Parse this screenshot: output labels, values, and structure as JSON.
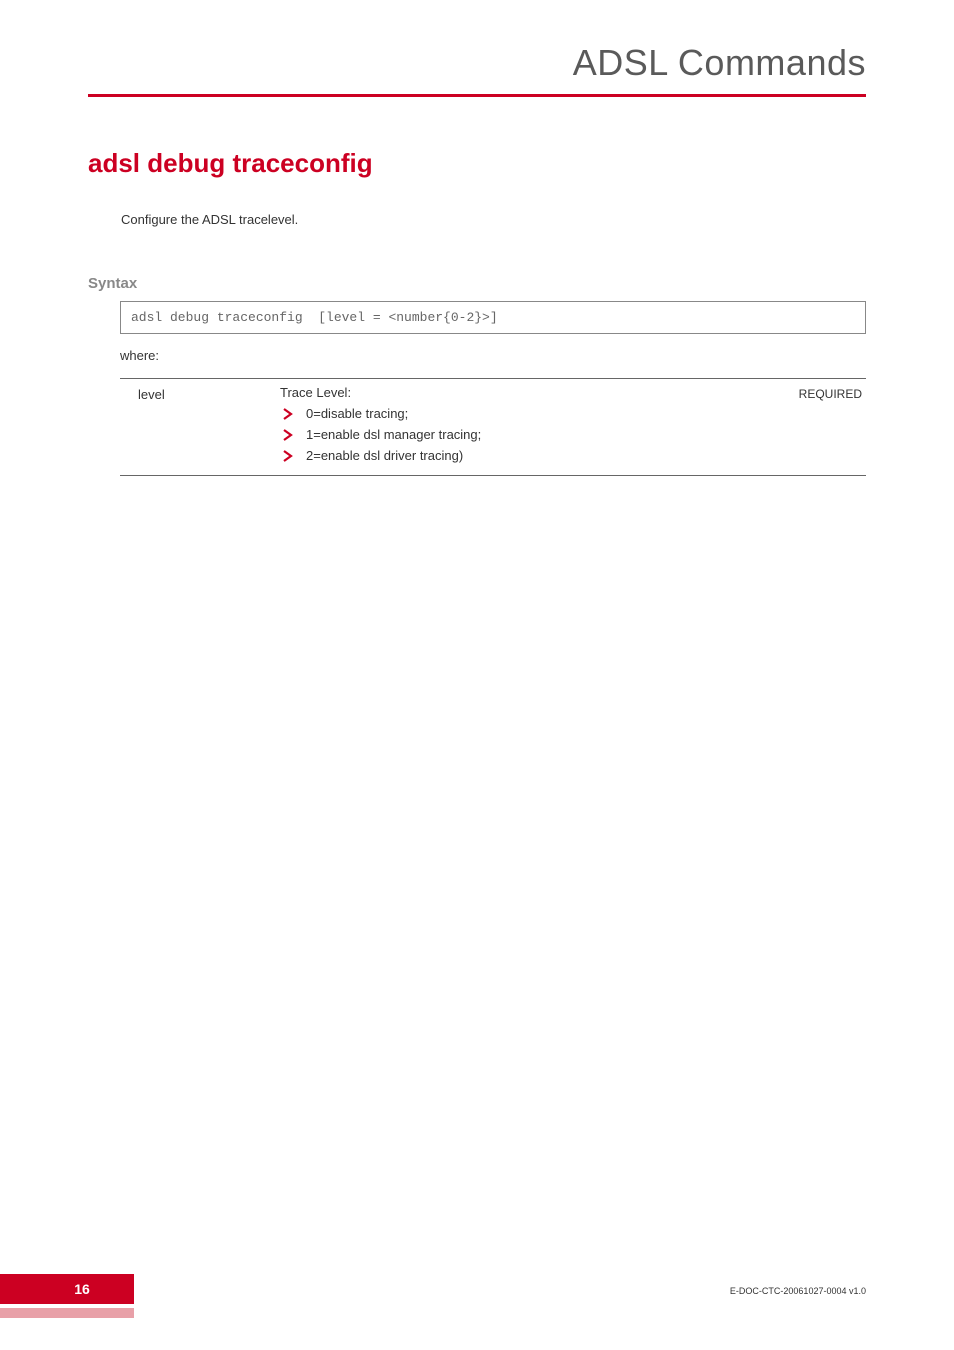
{
  "header": {
    "title": "ADSL Commands"
  },
  "section": {
    "title": "adsl debug traceconfig",
    "description": "Configure the ADSL tracelevel."
  },
  "syntax": {
    "heading": "Syntax",
    "code": "adsl debug traceconfig  [level = <number{0-2}>]",
    "where_label": "where:"
  },
  "params": {
    "name": "level",
    "desc_heading": "Trace Level:",
    "required": "REQUIRED",
    "bullets": [
      "0=disable tracing;",
      "1=enable dsl manager tracing;",
      "2=enable dsl driver tracing)"
    ]
  },
  "footer": {
    "page": "16",
    "doc": "E-DOC-CTC-20061027-0004 v1.0"
  }
}
